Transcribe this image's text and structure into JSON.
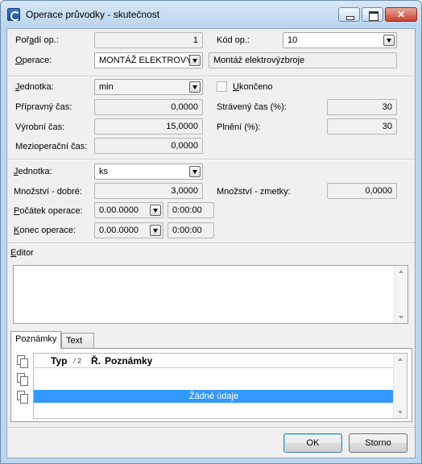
{
  "window": {
    "title": "Operace průvodky - skutečnost"
  },
  "header": {
    "poradi_label": "Pořadí op.:",
    "poradi_value": "1",
    "kod_label": "Kód op.:",
    "kod_value": "10",
    "operace_label": "Operace:",
    "operace_value": "MONTÁŽ ELEKTROVÝZ.",
    "operace_desc": "Montáž elektrovýzbroje"
  },
  "time": {
    "jednotka_label": "Jednotka:",
    "jednotka_value": "min",
    "ukonceno_label": "Ukončeno",
    "ukonceno_checked": false,
    "pripravny_label": "Přípravný čas:",
    "pripravny_value": "0,0000",
    "straveny_label": "Strávený čas (%):",
    "straveny_value": "30",
    "vyrobni_label": "Výrobní čas:",
    "vyrobni_value": "15,0000",
    "plneni_label": "Plnění (%):",
    "plneni_value": "30",
    "mezioperacni_label": "Mezioperační čas:",
    "mezioperacni_value": "0,0000"
  },
  "quantity": {
    "jednotka_label": "Jednotka:",
    "jednotka_value": "ks",
    "dobre_label": "Množství - dobré:",
    "dobre_value": "3,0000",
    "zmetky_label": "Množství - zmetky:",
    "zmetky_value": "0,0000",
    "pocatek_label": "Počátek operace:",
    "pocatek_date": "0.00.0000",
    "pocatek_time": "0:00:00",
    "konec_label": "Konec operace:",
    "konec_date": "0.00.0000",
    "konec_time": "0:00:00"
  },
  "editor": {
    "label": "Editor",
    "value": ""
  },
  "tabs": [
    {
      "label": "Poznámky",
      "active": true
    },
    {
      "label": "Text",
      "active": false
    }
  ],
  "notes_grid": {
    "columns": [
      "Typ",
      "Ř.",
      "Poznámky"
    ],
    "sort_indicator": "⁄ 2",
    "empty_text": "Žádné údaje"
  },
  "icons": [
    "new-note-icon",
    "edit-note-icon",
    "delete-note-icon"
  ],
  "buttons": {
    "ok": "OK",
    "cancel": "Storno"
  },
  "colors": {
    "selection": "#3399ff",
    "window_frame": "#bcd6ee",
    "close_button": "#c7422c"
  }
}
